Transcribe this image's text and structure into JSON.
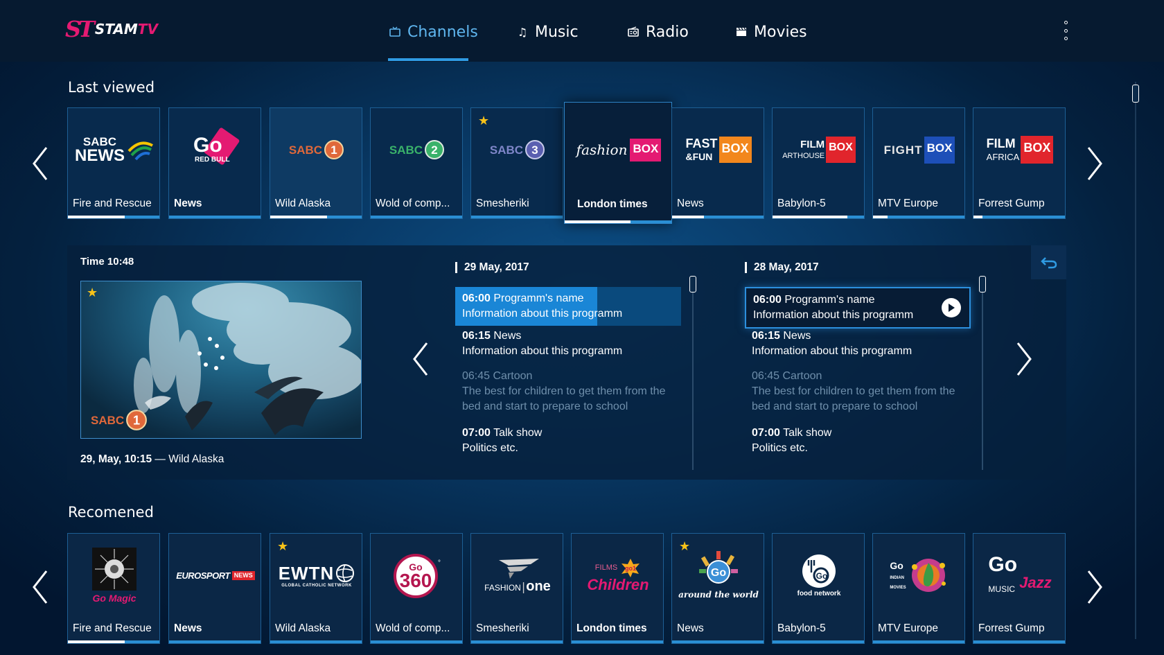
{
  "header": {
    "logo_mark": "ST",
    "logo_text_a": "STAM",
    "logo_text_b": "TV",
    "nav": [
      {
        "label": "Channels",
        "icon": "tv-icon",
        "active": true
      },
      {
        "label": "Music",
        "icon": "music-note-icon",
        "active": false
      },
      {
        "label": "Radio",
        "icon": "radio-icon",
        "active": false
      },
      {
        "label": "Movies",
        "icon": "clapperboard-icon",
        "active": false
      }
    ]
  },
  "last_viewed": {
    "title": "Last viewed",
    "tiles": [
      {
        "channel": "SABC NEWS",
        "caption": "Fire and Rescue",
        "progress": 0.62,
        "bold": false
      },
      {
        "channel": "Go RED BULL",
        "caption": "News",
        "progress": 0.0,
        "bold": true
      },
      {
        "channel": "SABC 1",
        "caption": "Wild Alaska",
        "progress": 0.62,
        "bold": false
      },
      {
        "channel": "SABC 2",
        "caption": "Wold of comp...",
        "progress": 0.0,
        "bold": false
      },
      {
        "channel": "SABC 3",
        "caption": "Smesheriki",
        "progress": 0.0,
        "bold": false,
        "starred": true
      },
      {
        "channel": "fashion BOX HD",
        "caption": "London times",
        "progress": 0.62,
        "bold": true,
        "selected": true
      },
      {
        "channel": "FAST&FUN BOX HD",
        "caption": "News",
        "progress": 0.35,
        "bold": false
      },
      {
        "channel": "FILM BOX ARTHOUSE",
        "caption": "Babylon-5",
        "progress": 0.82,
        "bold": false
      },
      {
        "channel": "FIGHT BOX HD",
        "caption": "MTV Europe",
        "progress": 0.16,
        "bold": false
      },
      {
        "channel": "FILM BOX AFRICA",
        "caption": "Forrest Gump",
        "progress": 0.1,
        "bold": false
      }
    ]
  },
  "detail": {
    "time_label": "Time 10:48",
    "preview_channel": "SABC 1",
    "preview_caption_date": "29, May, 10:15",
    "preview_caption_sep": " — ",
    "preview_caption_title": "Wild Alaska",
    "schedules": [
      {
        "date": "29 May, 2017",
        "items": [
          {
            "time": "06:00",
            "title": "Programm's name",
            "info": "Information about this programm",
            "state": "current",
            "progress": 0.63
          },
          {
            "time": "06:15",
            "title": "News",
            "info": "Information about this programm",
            "state": "normal"
          },
          {
            "time": "06:45",
            "title": "Cartoon",
            "info": "The best for children to get them from the bed and start to prepare to school",
            "state": "past"
          },
          {
            "time": "07:00",
            "title": "Talk show",
            "info": "Politics etc.",
            "state": "normal"
          }
        ]
      },
      {
        "date": "28 May, 2017",
        "items": [
          {
            "time": "06:00",
            "title": "Programm's name",
            "info": "Information about this programm",
            "state": "selected"
          },
          {
            "time": "06:15",
            "title": "News",
            "info": "Information about this programm",
            "state": "normal"
          },
          {
            "time": "06:45",
            "title": "Cartoon",
            "info": "The best for children to get them from the bed and start to prepare to school",
            "state": "past"
          },
          {
            "time": "07:00",
            "title": "Talk show",
            "info": "Politics etc.",
            "state": "normal"
          }
        ]
      }
    ]
  },
  "recommended": {
    "title": "Recomened",
    "tiles": [
      {
        "channel": "Go Magic",
        "caption": "Fire and Rescue",
        "progress": 0.62,
        "bold": false
      },
      {
        "channel": "EUROSPORT NEWS",
        "caption": "News",
        "progress": 0.0,
        "bold": true
      },
      {
        "channel": "EWTN GLOBAL CATHOLIC NETWORK",
        "caption": "Wild Alaska",
        "progress": 0.0,
        "bold": false,
        "starred": true
      },
      {
        "channel": "Go 360°",
        "caption": "Wold of comp...",
        "progress": 0.0,
        "bold": false
      },
      {
        "channel": "FASHION one",
        "caption": "Smesheriki",
        "progress": 0.0,
        "bold": false
      },
      {
        "channel": "Films Children",
        "caption": "London times",
        "progress": 0.0,
        "bold": true
      },
      {
        "channel": "Go around the world",
        "caption": "News",
        "progress": 0.0,
        "bold": false,
        "starred": true
      },
      {
        "channel": "Go food network",
        "caption": "Babylon-5",
        "progress": 0.0,
        "bold": false
      },
      {
        "channel": "Go Indian Movies",
        "caption": "MTV Europe",
        "progress": 0.0,
        "bold": false
      },
      {
        "channel": "Go MUSIC Jazz",
        "caption": "Forrest Gump",
        "progress": 0.0,
        "bold": false
      }
    ]
  },
  "colors": {
    "brand_pink": "#e41a72",
    "accent_blue": "#2f9be3",
    "star": "#f7c219"
  }
}
